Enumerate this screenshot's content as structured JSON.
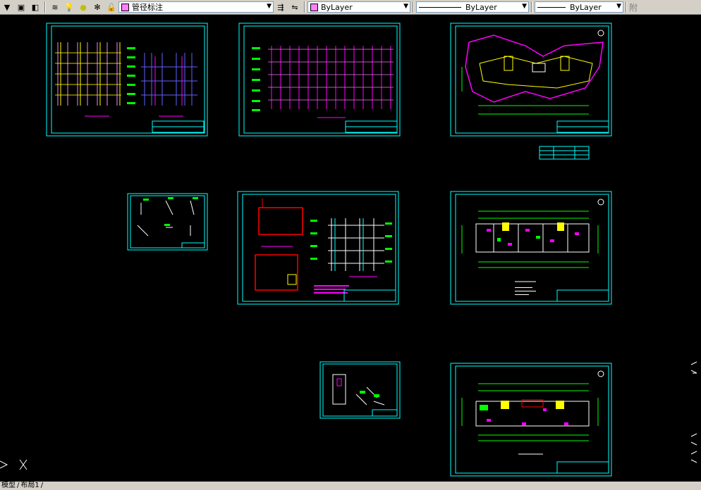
{
  "toolbar": {
    "layer_name": "管径标注",
    "color": "ByLayer",
    "linetype": "ByLayer",
    "lineweight": "ByLayer",
    "cut_label": "附"
  },
  "tabs": {
    "model": "模型",
    "layout1": "布局1"
  },
  "colors": {
    "sheet_border": "#00ffff",
    "pipe_magenta": "#ff00ff",
    "pipe_yellow": "#ffff00",
    "pipe_blue": "#4040ff",
    "text_green": "#00ff00"
  }
}
